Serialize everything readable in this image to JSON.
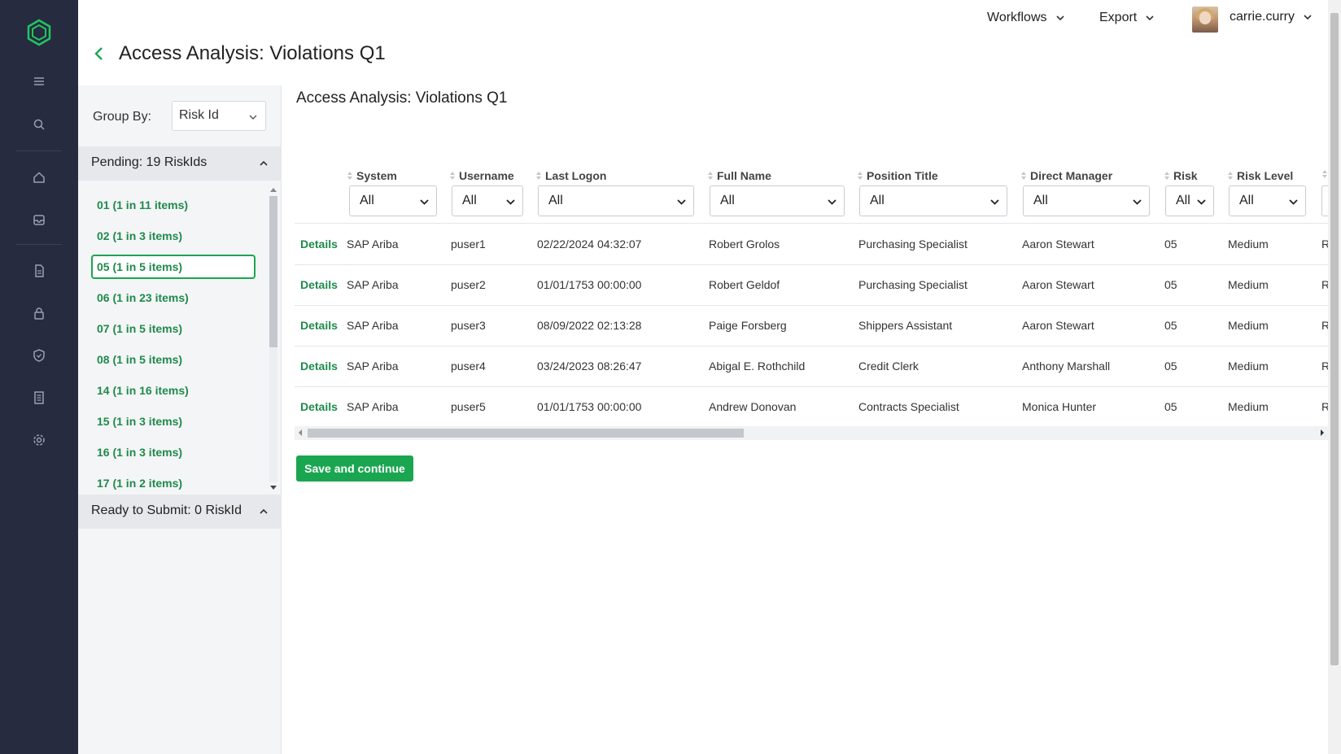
{
  "header": {
    "menus": [
      {
        "label": "Workflows",
        "icon": "chevron-down-icon"
      },
      {
        "label": "Export",
        "icon": "chevron-down-icon"
      }
    ],
    "user": {
      "name": "carrie.curry"
    }
  },
  "page": {
    "title": "Access Analysis: Violations Q1"
  },
  "sidebar": {
    "group_by_label": "Group By:",
    "group_by_value": "Risk Id",
    "pending_title": "Pending: 19 RiskIds",
    "ready_title": "Ready to Submit: 0 RiskId",
    "items": [
      {
        "label": "01 (1 in 11 items)"
      },
      {
        "label": "02 (1 in 3 items)"
      },
      {
        "label": "05 (1 in 5 items)",
        "selected": true
      },
      {
        "label": "06 (1 in 23 items)"
      },
      {
        "label": "07 (1 in 5 items)"
      },
      {
        "label": "08 (1 in 5 items)"
      },
      {
        "label": "14 (1 in 16 items)"
      },
      {
        "label": "15 (1 in 3 items)"
      },
      {
        "label": "16 (1 in 3 items)"
      },
      {
        "label": "17 (1 in 2 items)"
      }
    ]
  },
  "main": {
    "title": "Access Analysis: Violations Q1",
    "columns": [
      "System",
      "Username",
      "Last Logon",
      "Full Name",
      "Position Title",
      "Direct Manager",
      "Risk",
      "Risk Level"
    ],
    "filter_value": "All",
    "details_label": "Details",
    "rows": [
      [
        "SAP Ariba",
        "puser1",
        "02/22/2024 04:32:07",
        "Robert Grolos",
        "Purchasing Specialist",
        "Aaron Stewart",
        "05",
        "Medium",
        "R"
      ],
      [
        "SAP Ariba",
        "puser2",
        "01/01/1753 00:00:00",
        "Robert Geldof",
        "Purchasing Specialist",
        "Aaron Stewart",
        "05",
        "Medium",
        "R"
      ],
      [
        "SAP Ariba",
        "puser3",
        "08/09/2022 02:13:28",
        "Paige Forsberg",
        "Shippers Assistant",
        "Aaron Stewart",
        "05",
        "Medium",
        "R"
      ],
      [
        "SAP Ariba",
        "puser4",
        "03/24/2023 08:26:47",
        "Abigal E. Rothchild",
        "Credit Clerk",
        "Anthony Marshall",
        "05",
        "Medium",
        "R"
      ],
      [
        "SAP Ariba",
        "puser5",
        "01/01/1753 00:00:00",
        "Andrew Donovan",
        "Contracts Specialist",
        "Monica Hunter",
        "05",
        "Medium",
        "R"
      ]
    ],
    "save_label": "Save and continue"
  },
  "colors": {
    "accent": "#1aa650",
    "rail": "#262b40",
    "link": "#1f8a4c"
  },
  "nav_icons": [
    "logo-icon",
    "menu-icon",
    "search-icon",
    "home-icon",
    "inbox-icon",
    "document-icon",
    "lock-icon",
    "shield-icon",
    "report-icon",
    "settings-icon"
  ]
}
